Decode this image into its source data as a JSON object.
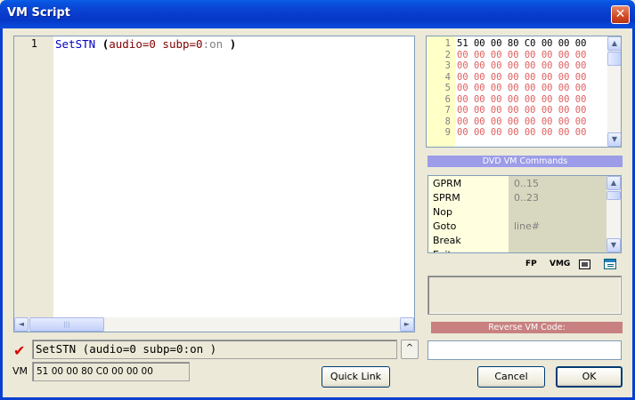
{
  "window": {
    "title": "VM Script",
    "close_glyph": "✕"
  },
  "editor": {
    "line_number": "1",
    "code": {
      "command": "SetSTN",
      "open_paren": "(",
      "args": "audio=0 subp=0",
      "colon_on": ":on",
      "close_paren": ")"
    }
  },
  "hscroll": {
    "left_glyph": "◄",
    "right_glyph": "►",
    "thumb_grip": "|||"
  },
  "command_field": {
    "value": "SetSTN (audio=0 subp=0:on )",
    "status_icon": "check-icon",
    "up_button_glyph": "^"
  },
  "vm": {
    "label": "VM",
    "value": "51 00 00 80 C0 00 00 00"
  },
  "buttons": {
    "quick_link": "Quick Link",
    "cancel": "Cancel",
    "ok": "OK"
  },
  "hex_view": {
    "lines": [
      {
        "num": "1",
        "bytes": "51 00 00 80 C0 00 00 00"
      },
      {
        "num": "2",
        "bytes": "00 00 00 00 00 00 00 00"
      },
      {
        "num": "3",
        "bytes": "00 00 00 00 00 00 00 00"
      },
      {
        "num": "4",
        "bytes": "00 00 00 00 00 00 00 00"
      },
      {
        "num": "5",
        "bytes": "00 00 00 00 00 00 00 00"
      },
      {
        "num": "6",
        "bytes": "00 00 00 00 00 00 00 00"
      },
      {
        "num": "7",
        "bytes": "00 00 00 00 00 00 00 00"
      },
      {
        "num": "8",
        "bytes": "00 00 00 00 00 00 00 00"
      },
      {
        "num": "9",
        "bytes": "00 00 00 00 00 00 00 00"
      }
    ],
    "up_glyph": "▲",
    "down_glyph": "▼"
  },
  "commands_panel": {
    "header": "DVD VM Commands",
    "items": [
      {
        "name": "GPRM",
        "arg": "0..15"
      },
      {
        "name": "SPRM",
        "arg": "0..23"
      },
      {
        "name": "Nop",
        "arg": ""
      },
      {
        "name": "Goto",
        "arg": "line#"
      },
      {
        "name": "Break",
        "arg": ""
      },
      {
        "name": "Exit",
        "arg": ""
      }
    ],
    "up_glyph": "▲",
    "down_glyph": "▼"
  },
  "tools": {
    "fp": "FP",
    "vmg": "VMG"
  },
  "reverse": {
    "header": "Reverse VM Code:",
    "value": ""
  },
  "colors": {
    "title_bar": "#0a3fd0",
    "dialog_bg": "#ece9d8",
    "keyword": "#0000c0",
    "argument": "#800000",
    "hex_zero": "#e06060",
    "commands_header": "#9c9ce8",
    "reverse_header": "#c88080",
    "check": "#d40000"
  }
}
